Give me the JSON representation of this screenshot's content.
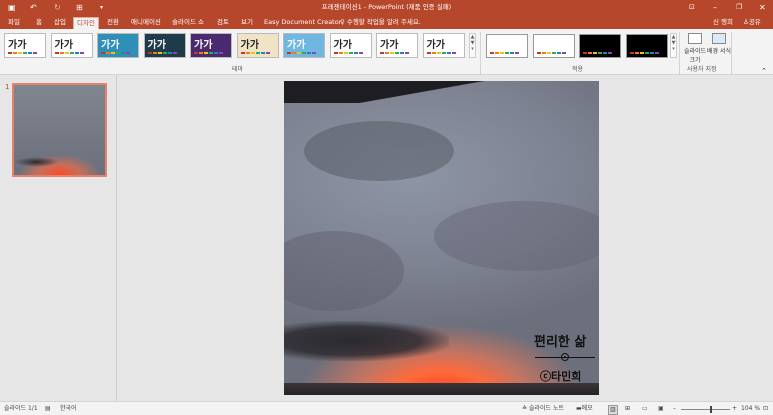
{
  "titlebar": {
    "title": "프레젠테이션1 - PowerPoint (제품 인증 실패)",
    "user": "신 행희",
    "share": "공유",
    "icons": [
      "save-icon",
      "undo-icon",
      "redo-icon",
      "start-slideshow-icon",
      "customize-qat-icon"
    ]
  },
  "tabs": [
    {
      "label": "파일"
    },
    {
      "label": "홈"
    },
    {
      "label": "삽입"
    },
    {
      "label": "디자인",
      "active": true
    },
    {
      "label": "전환"
    },
    {
      "label": "애니메이션"
    },
    {
      "label": "슬라이드 쇼"
    },
    {
      "label": "검토"
    },
    {
      "label": "보기"
    },
    {
      "label": "Easy Document Creator"
    }
  ],
  "tell_me": {
    "placeholder": "수행할 작업을 알려 주세요."
  },
  "ribbon": {
    "themes": [
      {
        "label": "가가",
        "bg": "#ffffff",
        "fg": "#222222"
      },
      {
        "label": "가가",
        "bg": "#ffffff",
        "fg": "#222222"
      },
      {
        "label": "가가",
        "bg": "#2f8fb7",
        "fg": "#ffffff"
      },
      {
        "label": "가가",
        "bg": "#1f3a48",
        "fg": "#ffffff"
      },
      {
        "label": "가가",
        "bg": "#4a2a6e",
        "fg": "#ffffff"
      },
      {
        "label": "가가",
        "bg": "#f0e3c6",
        "fg": "#222222"
      },
      {
        "label": "가가",
        "bg": "#6fb7e0",
        "fg": "#ffffff"
      },
      {
        "label": "가가",
        "bg": "#ffffff",
        "fg": "#222222"
      },
      {
        "label": "가가",
        "bg": "#ffffff",
        "fg": "#222222"
      },
      {
        "label": "가가",
        "bg": "#ffffff",
        "fg": "#222222"
      }
    ],
    "variants": [
      {
        "bg": "#ffffff"
      },
      {
        "bg": "#ffffff"
      },
      {
        "bg": "#000000"
      },
      {
        "bg": "#000000"
      }
    ],
    "slide_size_label": "슬라이드 크기",
    "format_bg_label": "배경 서식",
    "groups": {
      "theme": "테마",
      "variants": "적용",
      "customize": "사용자 지정"
    }
  },
  "thumbnail": {
    "number": "1"
  },
  "slide": {
    "title": "편리한 삶",
    "author": "ⓒ타민희"
  },
  "status": {
    "slide_info": "슬라이드 1/1",
    "language": "한국어",
    "notes": "슬라이드 노트",
    "comments": "메모",
    "zoom": "104 %",
    "zoom_level": 0.6
  }
}
